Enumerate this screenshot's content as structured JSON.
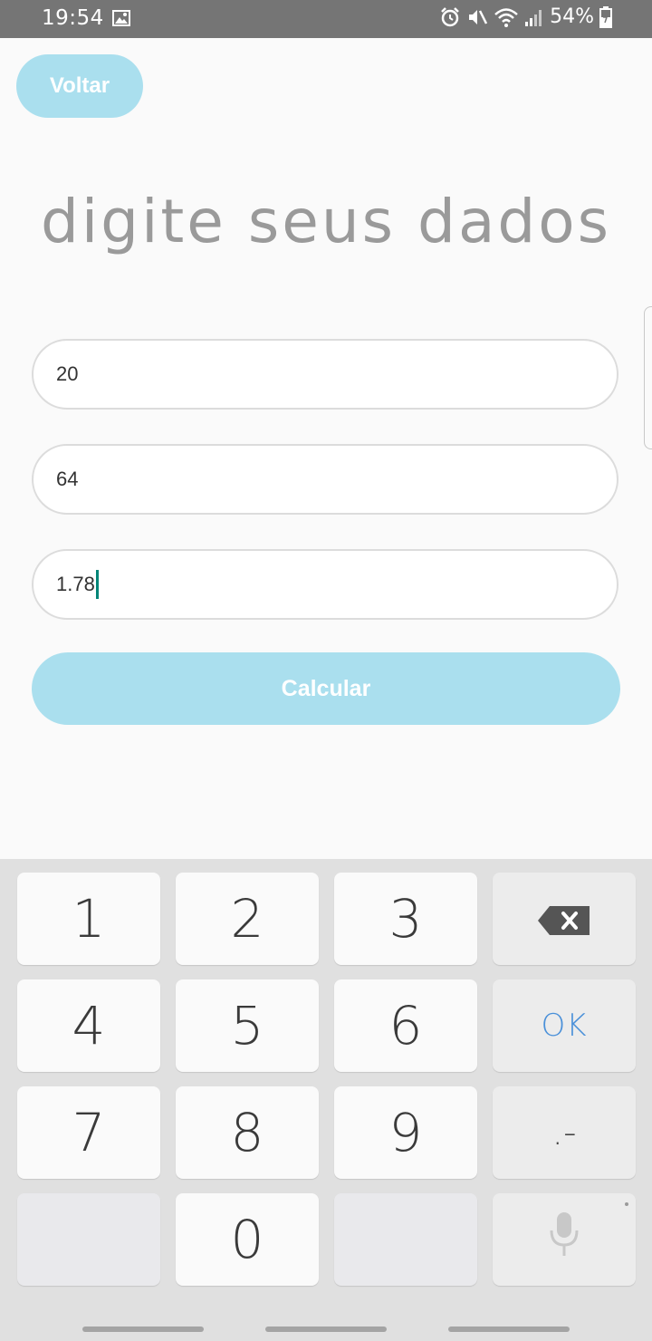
{
  "status_bar": {
    "time": "19:54",
    "battery": "54%",
    "icons": [
      "image-icon",
      "alarm-icon",
      "mute-icon",
      "wifi-icon",
      "signal-icon",
      "battery-icon"
    ]
  },
  "header": {
    "back_label": "Voltar",
    "title": "digite seus dados"
  },
  "form": {
    "field1_value": "20",
    "field2_value": "64",
    "field3_value": "1.78",
    "submit_label": "Calcular"
  },
  "keyboard": {
    "keys": [
      "1",
      "2",
      "3",
      "4",
      "5",
      "6",
      "7",
      "8",
      "9",
      "0"
    ],
    "ok_label": "OK",
    "punct_label": ".-",
    "icons": [
      "backspace-icon",
      "mic-icon"
    ]
  },
  "colors": {
    "accent": "#aadfee",
    "status_bar": "#757575",
    "ok_blue": "#4a90d9",
    "cursor": "#008577"
  }
}
